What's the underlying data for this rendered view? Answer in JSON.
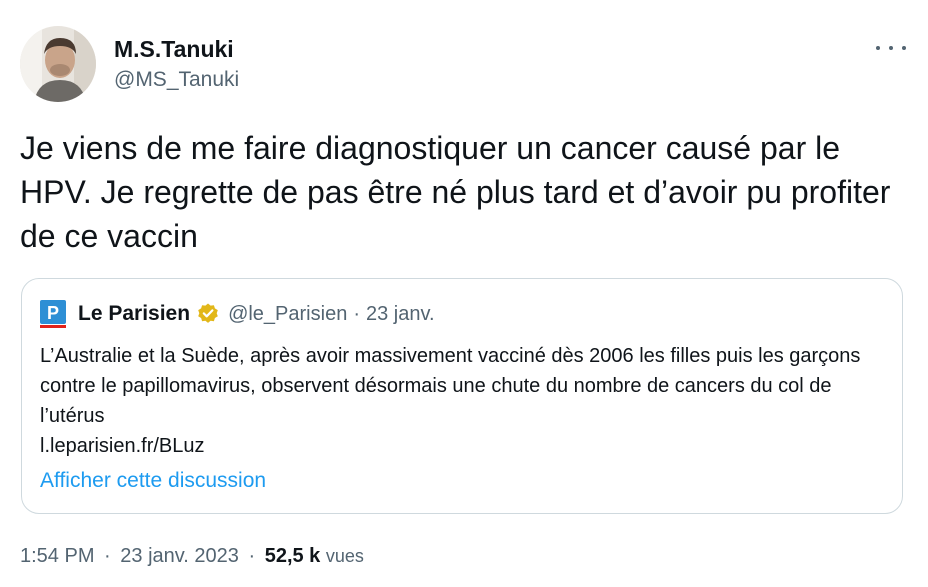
{
  "author": {
    "display_name": "M.S.Tanuki",
    "handle": "@MS_Tanuki",
    "avatar_icon": "user-photo"
  },
  "more_icon": "more-dots-icon",
  "tweet": {
    "text": "Je viens de me faire diagnostiquer un cancer causé par le HPV. Je regrette de pas être né plus tard et d’avoir pu profiter de ce vaccin"
  },
  "quote": {
    "logo_letter": "P",
    "name": "Le Parisien",
    "verified_icon": "gold-verified-badge",
    "handle": "@le_Parisien",
    "separator": "·",
    "date": "23 janv.",
    "body": "L’Australie et la Suède, après avoir massivement vacciné dès 2006 les filles puis les garçons contre le papillomavirus, observent désormais une chute du nombre de cancers du col de l’utérus",
    "link": "l.leparisien.fr/BLuz",
    "show_thread": "Afficher cette discussion"
  },
  "footer": {
    "time": "1:54 PM",
    "separator": "·",
    "date": "23 janv. 2023",
    "views_count": "52,5 k",
    "views_label": "vues"
  },
  "colors": {
    "text": "#0f1419",
    "secondary": "#536471",
    "link": "#1d9bf0",
    "border": "#cfd9de",
    "parisien_blue": "#2d8fd5",
    "verified_gold": "#e2b719"
  }
}
